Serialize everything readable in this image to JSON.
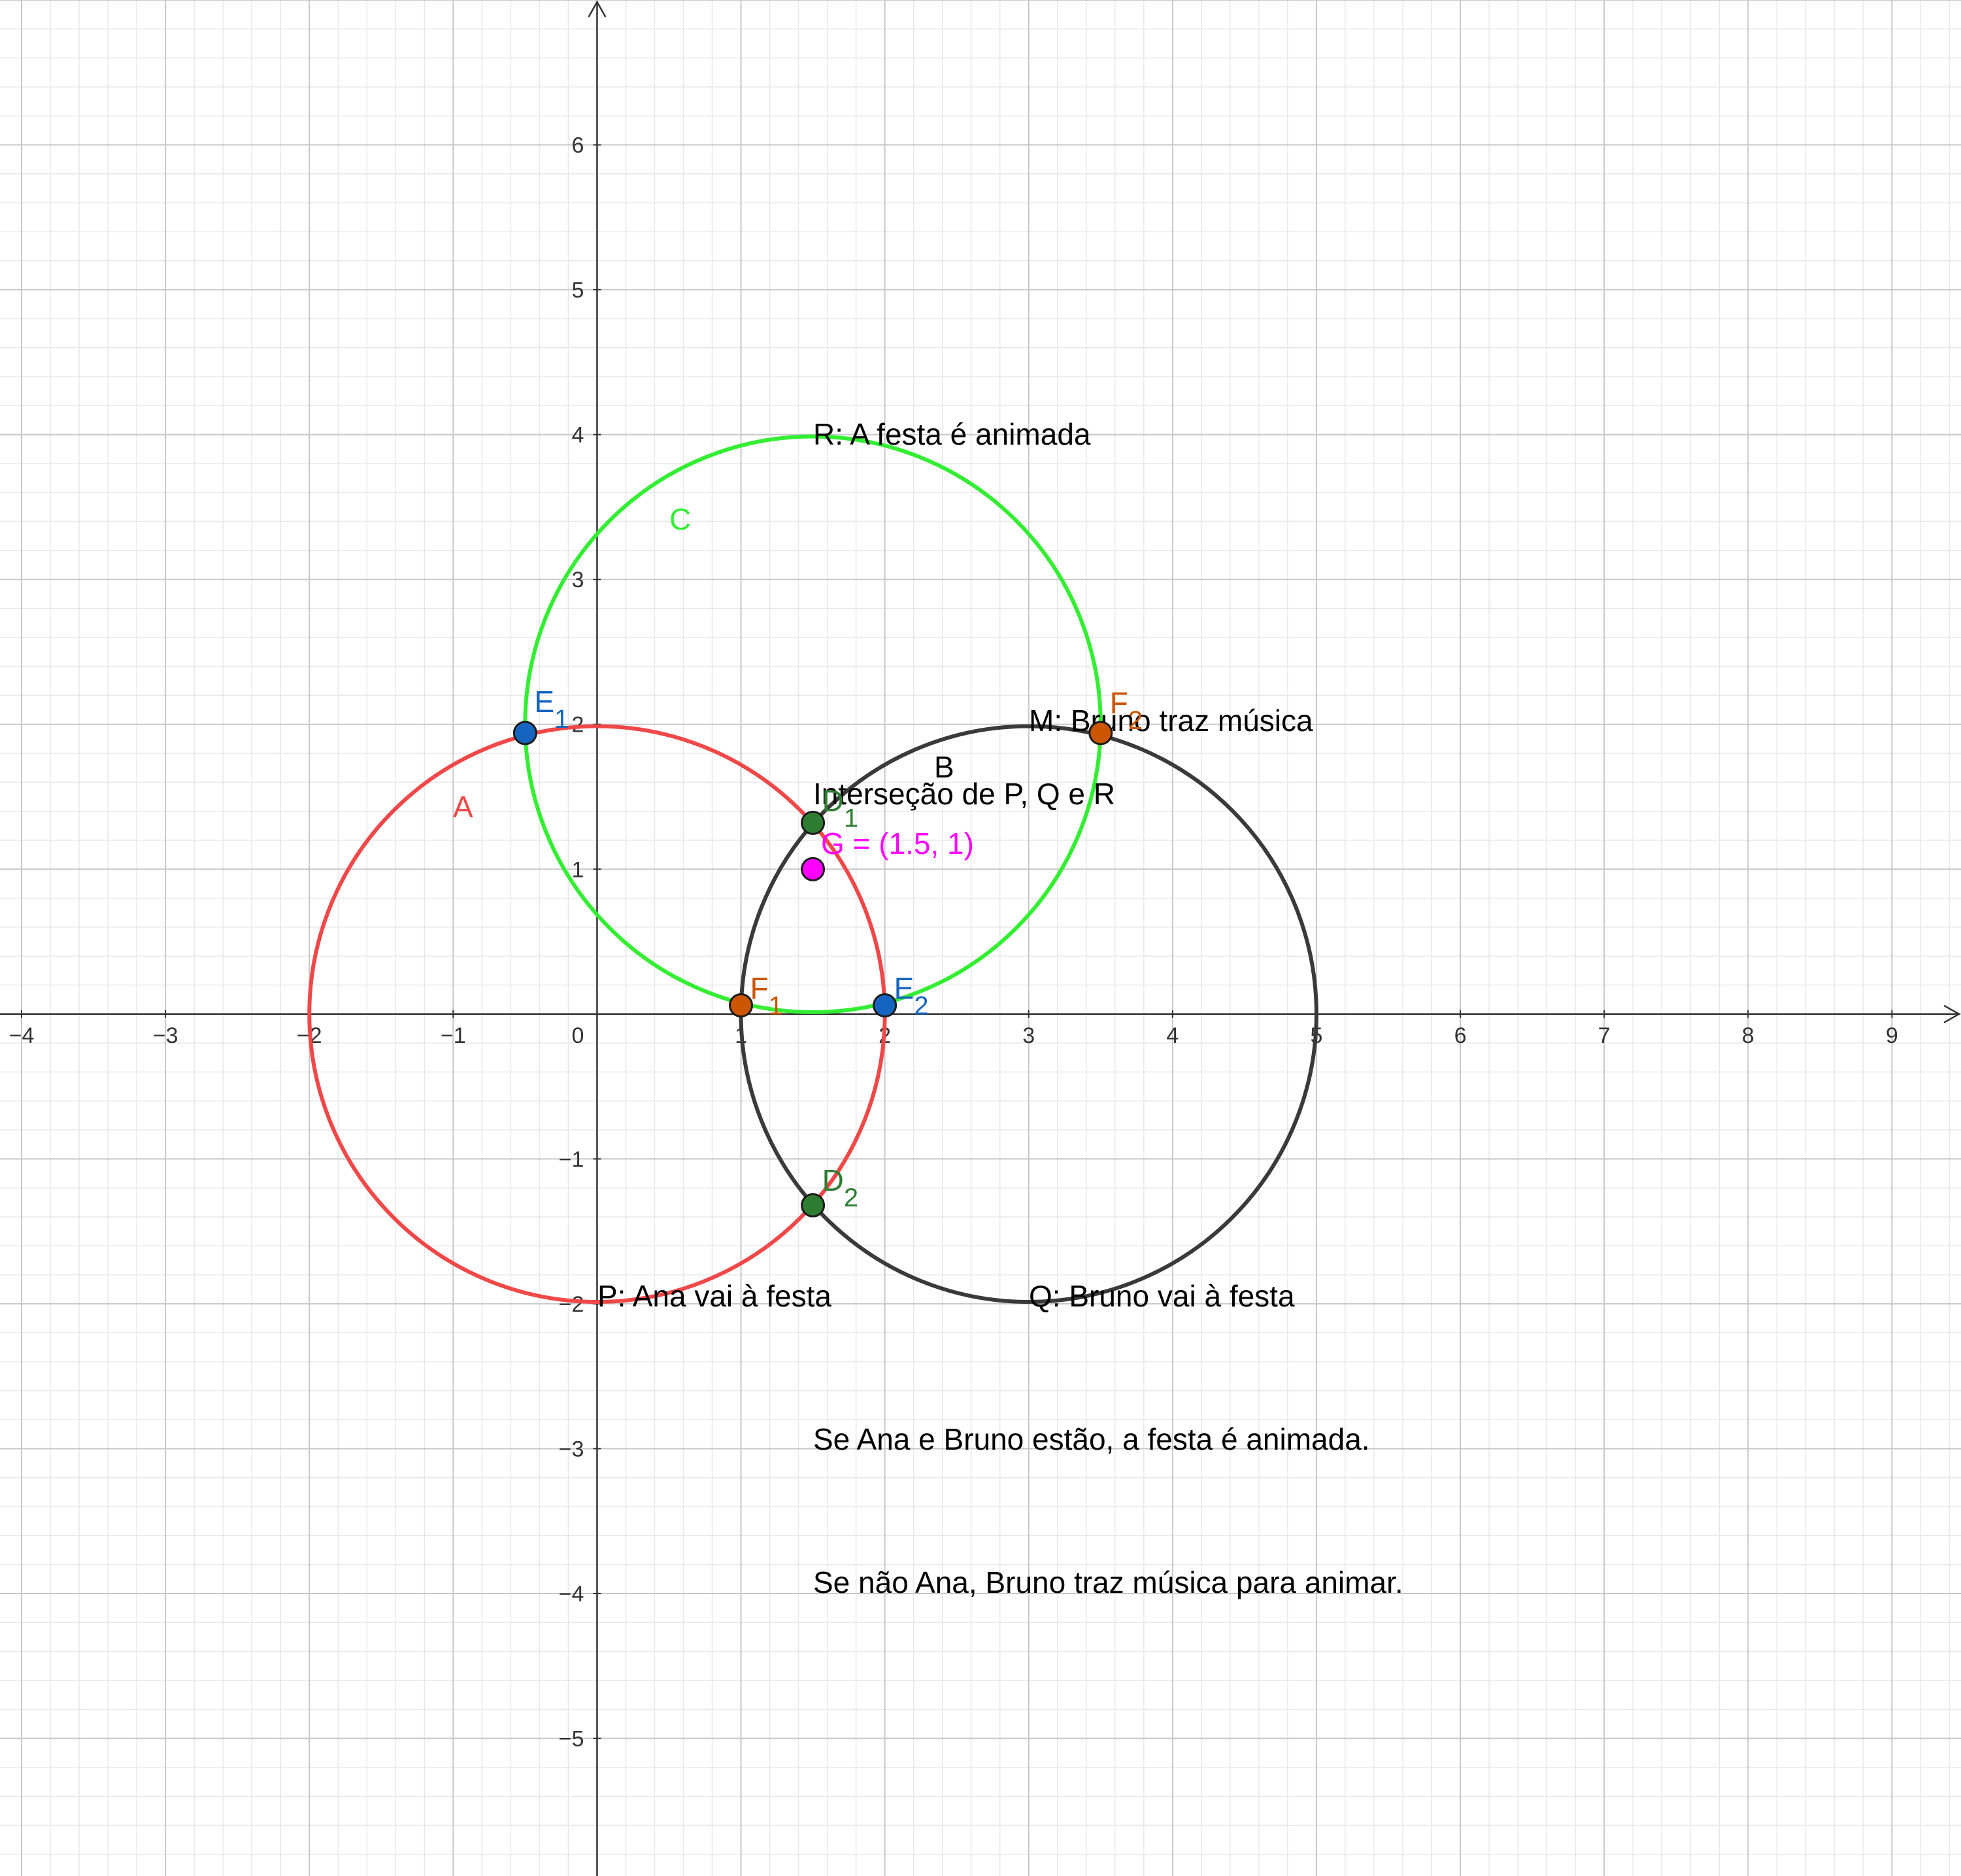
{
  "axes": {
    "x_ticks": [
      "−4",
      "−3",
      "−2",
      "−1",
      "0",
      "1",
      "2",
      "3",
      "4",
      "5",
      "6",
      "7",
      "8",
      "9"
    ],
    "y_ticks": [
      "6",
      "5",
      "4",
      "3",
      "2",
      "1",
      "−1",
      "−2",
      "−3",
      "−4",
      "−5"
    ],
    "x_range": [
      -4.15,
      9.48
    ],
    "y_range": [
      -5.95,
      7.0
    ],
    "grid": true,
    "minor_grid": true
  },
  "circles": [
    {
      "name": "A",
      "center": [
        0,
        0
      ],
      "radius": 2,
      "color": "#f04848"
    },
    {
      "name": "B",
      "center": [
        3,
        0
      ],
      "radius": 2,
      "color": "#3a3a3a"
    },
    {
      "name": "C",
      "center": [
        1.5,
        2
      ],
      "radius": 2,
      "color": "#33ee33"
    }
  ],
  "points": [
    {
      "id": "E1",
      "base": "E",
      "sub": "1",
      "x": -0.5,
      "y": 1.94,
      "fill": "#1565c0",
      "label_color": "#1565c0"
    },
    {
      "id": "E2",
      "base": "E",
      "sub": "2",
      "x": 2.0,
      "y": 0.06,
      "fill": "#1565c0",
      "label_color": "#1565c0"
    },
    {
      "id": "F1",
      "base": "F",
      "sub": "1",
      "x": 1.0,
      "y": 0.06,
      "fill": "#cc5500",
      "label_color": "#cc5500"
    },
    {
      "id": "F2",
      "base": "F",
      "sub": "2",
      "x": 3.5,
      "y": 1.94,
      "fill": "#cc5500",
      "label_color": "#cc5500"
    },
    {
      "id": "D1",
      "base": "D",
      "sub": "1",
      "x": 1.5,
      "y": 1.32,
      "fill": "#2e7d32",
      "label_color": "#2e7d32"
    },
    {
      "id": "D2",
      "base": "D",
      "sub": "2",
      "x": 1.5,
      "y": -1.32,
      "fill": "#2e7d32",
      "label_color": "#2e7d32"
    },
    {
      "id": "G",
      "x": 1.5,
      "y": 1.0,
      "fill": "#ff00ff",
      "label_color": "#ff00ff"
    }
  ],
  "labels": {
    "circle_A": "A",
    "circle_B": "B",
    "circle_C": "C",
    "R": "R: A festa é animada",
    "M": "M: Bruno traz música",
    "intersection": "Interseção de P, Q e R",
    "G": "G = (1.5, 1)",
    "P": "P: Ana vai à festa",
    "Q": "Q: Bruno vai à festa",
    "rule1": "Se Ana e Bruno estão, a festa é animada.",
    "rule2": "Se não Ana, Bruno traz música para animar."
  }
}
